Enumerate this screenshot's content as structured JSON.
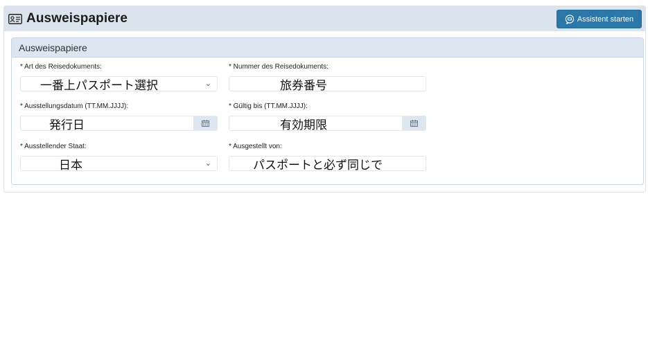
{
  "header": {
    "title": "Ausweispapiere",
    "title_icon": "id-card-icon",
    "assistant_button": {
      "label": "Assistent starten",
      "icon": "chat-assistant-icon"
    }
  },
  "panel": {
    "title": "Ausweispapiere",
    "fields": {
      "doc_type": {
        "label": "* Art des Reisedokuments:",
        "value": "一番上パスポート選択"
      },
      "doc_number": {
        "label": "* Nummer des Reisedokuments:",
        "value": "旅券番号"
      },
      "issue_date": {
        "label": "* Ausstellungsdatum (TT.MM.JJJJ):",
        "value": "発行日"
      },
      "valid_until": {
        "label": "* Gültig bis (TT.MM.JJJJ):",
        "value": "有効期限"
      },
      "issuing_state": {
        "label": "* Ausstellender Staat:",
        "value": "日本"
      },
      "issued_by": {
        "label": "* Ausgestellt von:",
        "value": "パスポートと必ず同じで"
      }
    }
  },
  "colors": {
    "header_bg": "#dbe4ec",
    "button_bg": "#2a77a8",
    "panel_header_bg": "#dbe6f0"
  }
}
